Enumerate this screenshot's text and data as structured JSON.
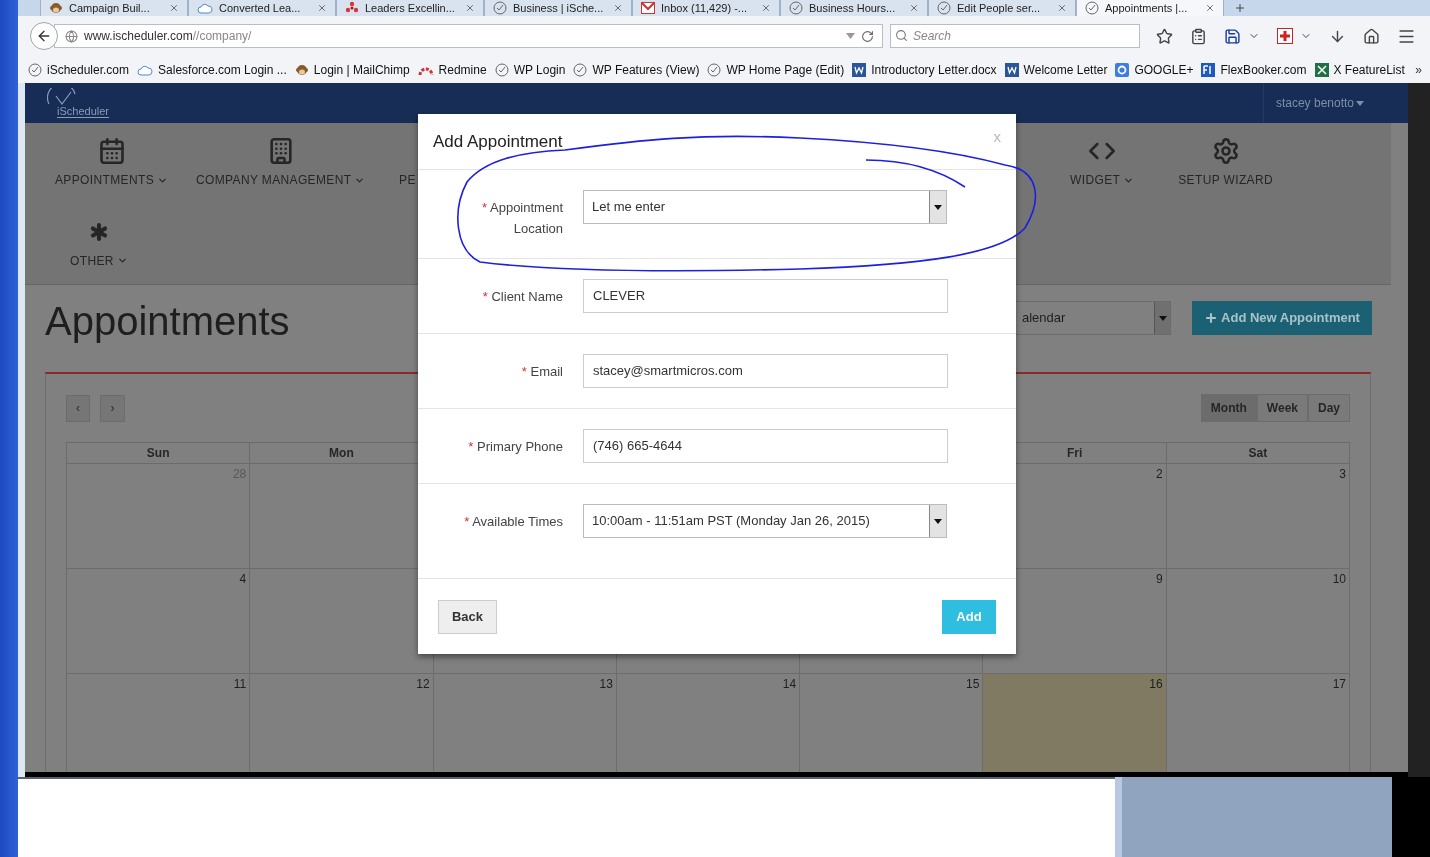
{
  "browser": {
    "tabs": [
      {
        "title": "Campaign Buil...",
        "kind": "monkey",
        "selected": false
      },
      {
        "title": "Converted Lea...",
        "kind": "cloud",
        "selected": false
      },
      {
        "title": "Leaders Excellin...",
        "kind": "flower",
        "selected": false
      },
      {
        "title": "Business | iSche...",
        "kind": "clock",
        "selected": false
      },
      {
        "title": "Inbox (11,429) -...",
        "kind": "mail",
        "selected": false
      },
      {
        "title": "Business Hours...",
        "kind": "clock",
        "selected": false
      },
      {
        "title": "Edit People ser...",
        "kind": "clock",
        "selected": false
      },
      {
        "title": "Appointments |...",
        "kind": "clock",
        "selected": true
      }
    ],
    "url": {
      "domain": "www.ischeduler.com",
      "path": "//company/"
    },
    "search": {
      "placeholder": "Search"
    },
    "bookmarks": [
      {
        "label": "iScheduler.com",
        "kind": "clock"
      },
      {
        "label": "Salesforce.com Login ...",
        "kind": "cloud"
      },
      {
        "label": "Login | MailChimp",
        "kind": "monkey"
      },
      {
        "label": "Redmine",
        "kind": "arc"
      },
      {
        "label": "WP Login",
        "kind": "clock"
      },
      {
        "label": "WP Features (View)",
        "kind": "clock"
      },
      {
        "label": "WP Home Page (Edit)",
        "kind": "clock"
      },
      {
        "label": "Introductory Letter.docx",
        "kind": "word"
      },
      {
        "label": "Welcome Letter",
        "kind": "word"
      },
      {
        "label": "GOOGLE+",
        "kind": "google"
      },
      {
        "label": "FlexBooker.com",
        "kind": "flexbooker"
      },
      {
        "label": "X FeatureList",
        "kind": "excel"
      }
    ],
    "bookmarks_more": "»"
  },
  "app": {
    "logo": "iScheduler",
    "user": "stacey benotto",
    "menu": {
      "rows": [
        {
          "groups": [
            {
              "items": [
                {
                  "label": "APPOINTMENTS",
                  "kind": "calendar",
                  "dropdown": true
                },
                {
                  "label": "COMPANY MANAGEMENT",
                  "kind": "building",
                  "dropdown": true
                },
                {
                  "label": "PE",
                  "kind": "hidden"
                }
              ]
            },
            {
              "items": [
                {
                  "label": "WIDGET",
                  "kind": "code",
                  "dropdown": true
                },
                {
                  "label": "SETUP WIZARD",
                  "kind": "gears",
                  "dropdown": false
                }
              ]
            }
          ]
        },
        {
          "groups": [
            {
              "items": [
                {
                  "label": "OTHER",
                  "kind": "asterisk",
                  "dropdown": true
                }
              ]
            }
          ]
        }
      ]
    },
    "heading": "Appointments",
    "calendar_select": {
      "value": "alendar"
    },
    "add_button": {
      "label": "Add New Appointment"
    },
    "calendar": {
      "prev": "‹",
      "next": "›",
      "views": [
        {
          "label": "Month",
          "selected": true
        },
        {
          "label": "Week",
          "selected": false
        },
        {
          "label": "Day",
          "selected": false
        }
      ],
      "headers": [
        {
          "label": "Sun"
        },
        {
          "label": "Mon"
        },
        {
          "label": "Fri"
        },
        {
          "label": "Sat"
        }
      ],
      "weeks": [
        {
          "days": [
            {
              "day": "28",
              "other_month": true,
              "today": false
            },
            {
              "day": "2",
              "other_month": false,
              "today": false
            },
            {
              "day": "3",
              "other_month": false,
              "today": false
            }
          ]
        },
        {
          "days": [
            {
              "day": "4",
              "other_month": false,
              "today": false
            },
            {
              "day": "9",
              "other_month": false,
              "today": false
            },
            {
              "day": "10",
              "other_month": false,
              "today": false
            }
          ]
        },
        {
          "days": [
            {
              "day": "11",
              "other_month": false,
              "today": false
            },
            {
              "day": "12",
              "other_month": false,
              "today": false
            },
            {
              "day": "13",
              "other_month": false,
              "today": false
            },
            {
              "day": "14",
              "other_month": false,
              "today": false
            },
            {
              "day": "15",
              "other_month": false,
              "today": false
            },
            {
              "day": "16",
              "other_month": false,
              "today": true
            },
            {
              "day": "17",
              "other_month": false,
              "today": false
            }
          ]
        }
      ]
    }
  },
  "modal": {
    "title": "Add Appointment",
    "close": "x",
    "fields": [
      {
        "kind": "select",
        "mark": "*",
        "label": "Appointment Location",
        "value": "Let me enter"
      },
      {
        "kind": "input",
        "mark": "*",
        "label": "Client Name",
        "value": "CLEVER"
      },
      {
        "kind": "input",
        "mark": "*",
        "label": "Email",
        "value": "stacey@smartmicros.com"
      },
      {
        "kind": "input",
        "mark": "*",
        "label": "Primary Phone",
        "value": "(746) 665-4644"
      },
      {
        "kind": "select",
        "mark": "*",
        "label": "Available Times",
        "value": "10:00am - 11:51am PST (Monday Jan 26, 2015)"
      }
    ],
    "buttons": [
      {
        "label": "Back",
        "kind": "default"
      },
      {
        "label": "Add",
        "kind": "primary"
      }
    ]
  }
}
